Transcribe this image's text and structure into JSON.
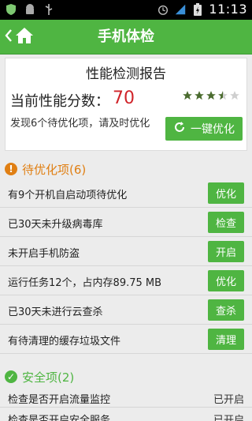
{
  "status_bar": {
    "time": "11:13",
    "icons": [
      "shield-icon",
      "android-icon",
      "usb-icon",
      "alarm-icon",
      "signal-icon",
      "battery-icon"
    ]
  },
  "header": {
    "title": "手机体检",
    "back_icon": "chevron-left-icon",
    "home_icon": "home-icon"
  },
  "report": {
    "title": "性能检测报告",
    "score_label": "当前性能分数：",
    "score": "70",
    "stars": 3.5,
    "found_text": "发现6个待优化项，请及时优化",
    "optimize_button": "一键优化"
  },
  "pending_section": {
    "title": "待优化项(6)",
    "items": [
      {
        "label": "有9个开机自启动项待优化",
        "action": "优化"
      },
      {
        "label": "已30天未升级病毒库",
        "action": "检查"
      },
      {
        "label": "未开启手机防盗",
        "action": "开启"
      },
      {
        "label": "运行任务12个，占内存89.75 MB",
        "action": "优化"
      },
      {
        "label": "已30天未进行云查杀",
        "action": "查杀"
      },
      {
        "label": "有待清理的缓存垃圾文件",
        "action": "清理"
      }
    ]
  },
  "safe_section": {
    "title": "安全项(2)",
    "items": [
      {
        "label": "检查是否开启流量监控",
        "state": "已开启"
      },
      {
        "label": "检查是否开启安全服务",
        "state": "已开启"
      }
    ]
  },
  "colors": {
    "accent": "#4fb542",
    "score": "#d0242a",
    "warning": "#e07f13"
  }
}
